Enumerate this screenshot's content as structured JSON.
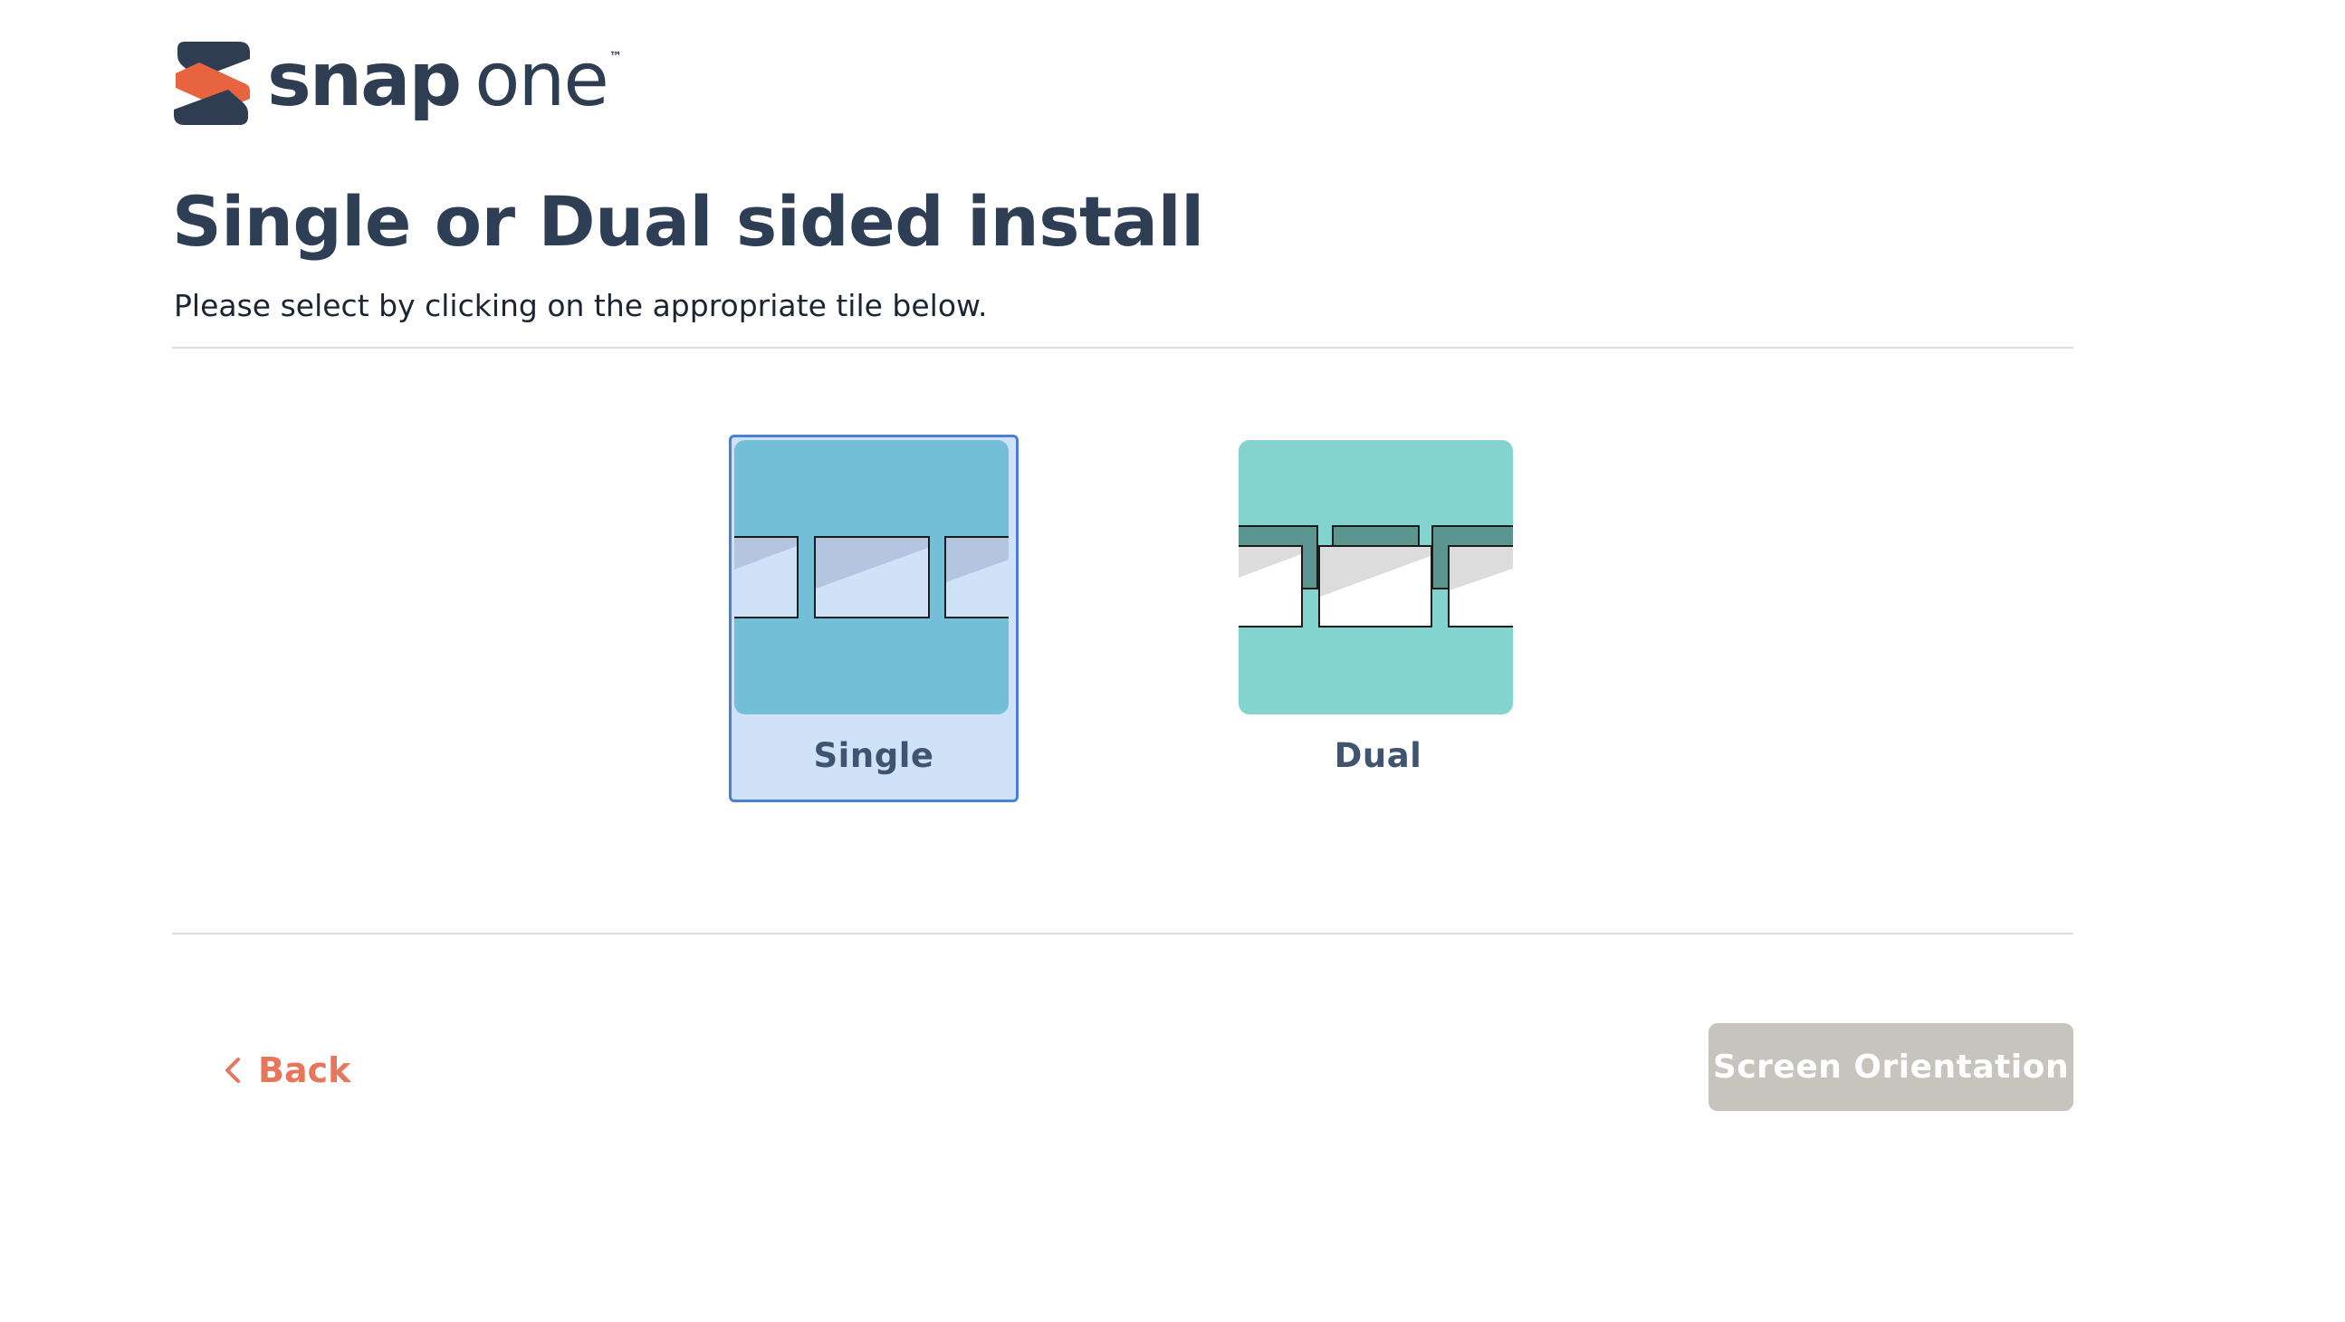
{
  "brand": {
    "name_bold": "snap",
    "name_light": "one",
    "trademark": "™",
    "colors": {
      "navy": "#2f3d52",
      "orange": "#e8633f"
    }
  },
  "header": {
    "title": "Single or Dual sided install",
    "subtitle": "Please select by clicking on the appropriate tile below."
  },
  "options": [
    {
      "label": "Single",
      "selected": true,
      "icon": "single-sided-wall-icon",
      "tile_color": "#d0e2f8",
      "art_color": "#74bfd8"
    },
    {
      "label": "Dual",
      "selected": false,
      "icon": "dual-sided-wall-icon",
      "art_color": "#83d4cf"
    }
  ],
  "footer": {
    "back_label": "Back",
    "back_icon": "chevron-left-icon",
    "back_color": "#e8765a",
    "next_label": "Screen Orientation",
    "next_enabled": false,
    "next_color": "#c7c3bd"
  }
}
